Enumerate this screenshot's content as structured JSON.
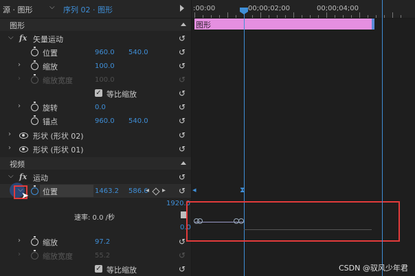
{
  "header": {
    "source_tab": "源 · 图形",
    "sequence_tab": "序列 02 · 图形"
  },
  "sections": {
    "graphic": "图形",
    "video": "视频"
  },
  "vector_motion": {
    "title": "矢量运动",
    "position": {
      "label": "位置",
      "x": "960.0",
      "y": "540.0"
    },
    "scale": {
      "label": "缩放",
      "value": "100.0"
    },
    "scale_width": {
      "label": "缩放宽度",
      "value": "100.0"
    },
    "uniform_scale": {
      "label": "等比缩放"
    },
    "rotation": {
      "label": "旋转",
      "value": "0.0"
    },
    "anchor": {
      "label": "锚点",
      "x": "960.0",
      "y": "540.0"
    }
  },
  "shapes": [
    {
      "label": "形状 (形状 02)"
    },
    {
      "label": "形状 (形状 01)"
    }
  ],
  "motion": {
    "title": "运动",
    "position": {
      "label": "位置",
      "x": "1463.2",
      "y": "586.6"
    },
    "graph_max": "1920.0",
    "velocity": "速率: 0.0 /秒",
    "graph_min": "0.0",
    "scale": {
      "label": "缩放",
      "value": "97.2"
    },
    "scale_width": {
      "label": "缩放宽度",
      "value": "55.2"
    },
    "uniform_scale": {
      "label": "等比缩放"
    }
  },
  "timeline": {
    "tc_start": ":00:00",
    "tc_mid": "00;00;02;00",
    "tc_end": "00;00;04;00",
    "clip_label": "图形"
  },
  "watermark": "CSDN @驭风少年君",
  "colors": {
    "accent": "#3f8fd8",
    "clip": "#e58fe0",
    "highlight": "#e23b3b"
  }
}
